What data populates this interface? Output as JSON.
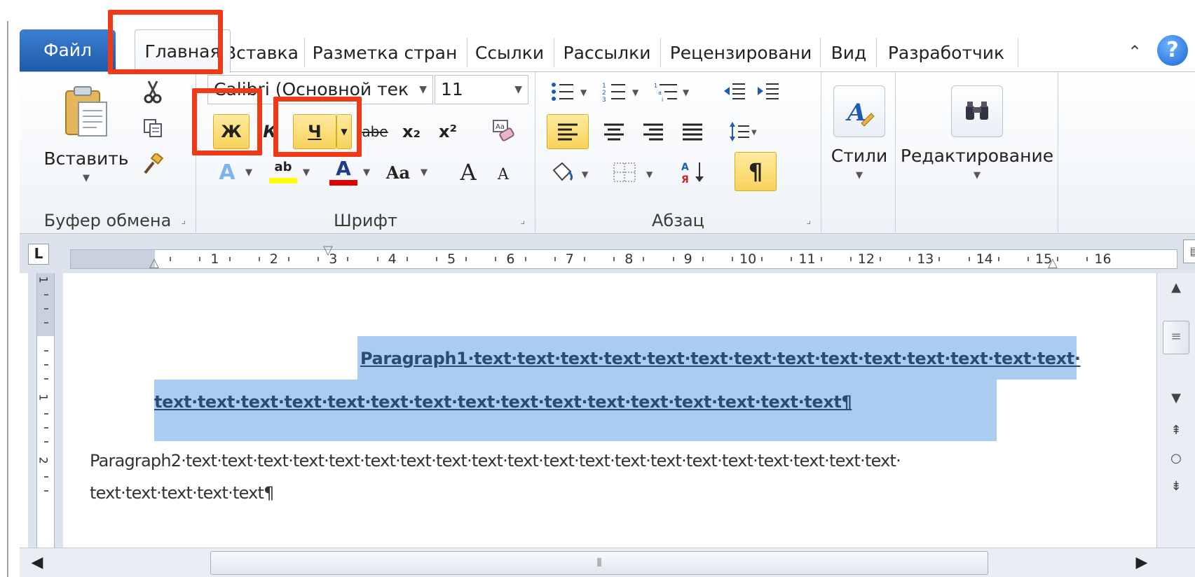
{
  "tabs": {
    "file": "Файл",
    "home": "Главная",
    "insert": "Вставка",
    "layout": "Разметка стран",
    "references": "Ссылки",
    "mailings": "Рассылки",
    "review": "Рецензировани",
    "view": "Вид",
    "developer": "Разработчик",
    "collapse_glyph": "⌃",
    "help_glyph": "?"
  },
  "clipboard": {
    "paste_label": "Вставить",
    "group_label": "Буфер обмена"
  },
  "font": {
    "font_name": "Calibri (Основной тек",
    "font_size": "11",
    "bold_label": "Ж",
    "italic_label": "К",
    "underline_label": "Ч",
    "strike_label": "abe",
    "subscript_label": "x₂",
    "superscript_label": "x²",
    "case_label": "Aa",
    "grow_label": "A",
    "shrink_label": "A",
    "text_effects_label": "A",
    "font_color_label": "A",
    "highlight_label": "ab",
    "group_label": "Шрифт"
  },
  "paragraph": {
    "group_label": "Абзац",
    "pilcrow": "¶"
  },
  "styles": {
    "label": "Стили"
  },
  "editing": {
    "label": "Редактирование"
  },
  "ruler": {
    "tab_selector": "L",
    "numbers": [
      "1",
      "2",
      "3",
      "4",
      "5",
      "6",
      "7",
      "8",
      "9",
      "10",
      "11",
      "12",
      "13",
      "14",
      "15",
      "16"
    ]
  },
  "vruler": {
    "numbers": [
      "1",
      "1",
      "2"
    ]
  },
  "document": {
    "p1_line1": "Paragraph1·text·text·text·text·text·text·text·text·text·text·text·text·text·text·",
    "p1_line2": "text·text·text·text·text·text·text·text·text·text·text·text·text·text·text·text¶",
    "p2_line1": "Paragraph2·text·text·text·text·text·text·text·text·text·text·text·text·text·text·text·text·text·text·text·text·",
    "p2_line2": "text·text·text·text·text¶"
  },
  "colors": {
    "file_tab": "#2a6bc1",
    "selection": "#a9cdf1",
    "highlight_active": "#f8d35a",
    "annotation_red": "#f03a17"
  }
}
